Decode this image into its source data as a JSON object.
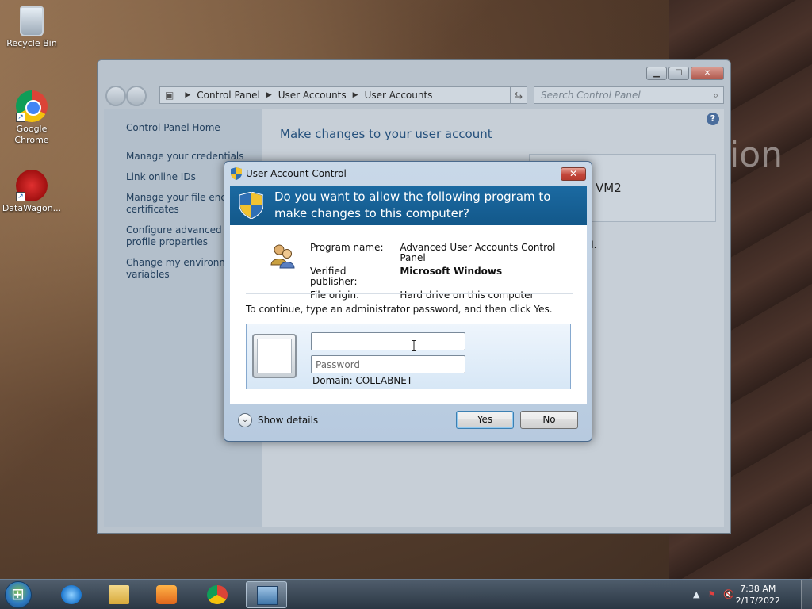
{
  "desktop": {
    "icons": [
      {
        "label": "Recycle Bin",
        "icon": "recycle-bin-icon"
      },
      {
        "label": "Google Chrome",
        "icon": "chrome-icon"
      },
      {
        "label": "DataWagon...",
        "icon": "datawagon-icon"
      }
    ],
    "wallpaper_text": "ion"
  },
  "control_panel": {
    "breadcrumb": [
      "Control Panel",
      "User Accounts",
      "User Accounts"
    ],
    "search_placeholder": "Search Control Panel",
    "sidebar": [
      "Control Panel Home",
      "Manage your credentials",
      "Link online IDs",
      "Manage your file encry certificates",
      "Configure advanced us profile properties",
      "Change my environme variables"
    ],
    "heading": "Make changes to your user account",
    "account_name_fragment": "VM2",
    "text_fragment": "d."
  },
  "uac": {
    "title": "User Account Control",
    "close_label": "✕",
    "question": "Do you want to allow the following program to make changes to this computer?",
    "program_name_label": "Program name:",
    "program_name": "Advanced User Accounts Control Panel",
    "publisher_label": "Verified publisher:",
    "publisher": "Microsoft Windows",
    "origin_label": "File origin:",
    "origin": "Hard drive on this computer",
    "instruction": "To continue, type an administrator password, and then click Yes.",
    "username_value": "",
    "password_placeholder": "Password",
    "domain": "Domain: COLLABNET",
    "show_details": "Show details",
    "yes_label": "Yes",
    "no_label": "No"
  },
  "taskbar": {
    "items": [
      "internet-explorer-icon",
      "file-explorer-icon",
      "media-player-icon",
      "chrome-icon",
      "control-panel-icon"
    ],
    "time": "7:38 AM",
    "date": "2/17/2022"
  }
}
